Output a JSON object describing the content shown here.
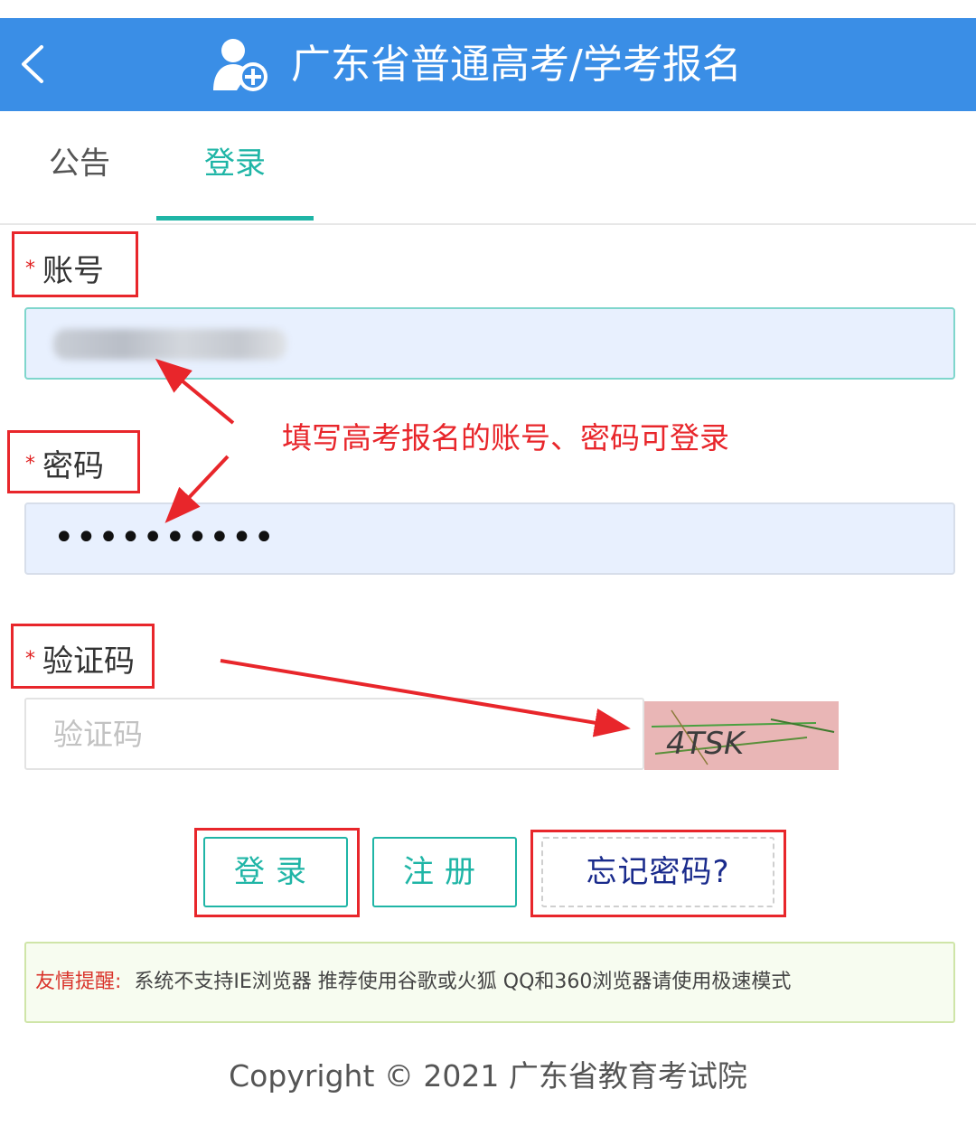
{
  "header": {
    "title": "广东省普通高考/学考报名"
  },
  "tabs": [
    {
      "label": "公告"
    },
    {
      "label": "登录"
    }
  ],
  "form": {
    "account": {
      "label": "账号",
      "required_mark": "*"
    },
    "password": {
      "label": "密码",
      "required_mark": "*",
      "masked_value": "••••••••••"
    },
    "captcha": {
      "label": "验证码",
      "required_mark": "*",
      "placeholder": "验证码",
      "image_text": "4TSK"
    }
  },
  "annotation": {
    "text": "填写高考报名的账号、密码可登录"
  },
  "buttons": {
    "login": "登录",
    "register": "注册",
    "forgot": "忘记密码?"
  },
  "notice": {
    "label": "友情提醒:",
    "text": "系统不支持IE浏览器 推荐使用谷歌或火狐 QQ和360浏览器请使用极速模式"
  },
  "footer": {
    "copyright": "Copyright © 2021 广东省教育考试院"
  },
  "colors": {
    "header": "#3a8ee6",
    "accent": "#1fb5a6",
    "annotation_red": "#e8262b",
    "forgot_text": "#1a2b8c"
  }
}
